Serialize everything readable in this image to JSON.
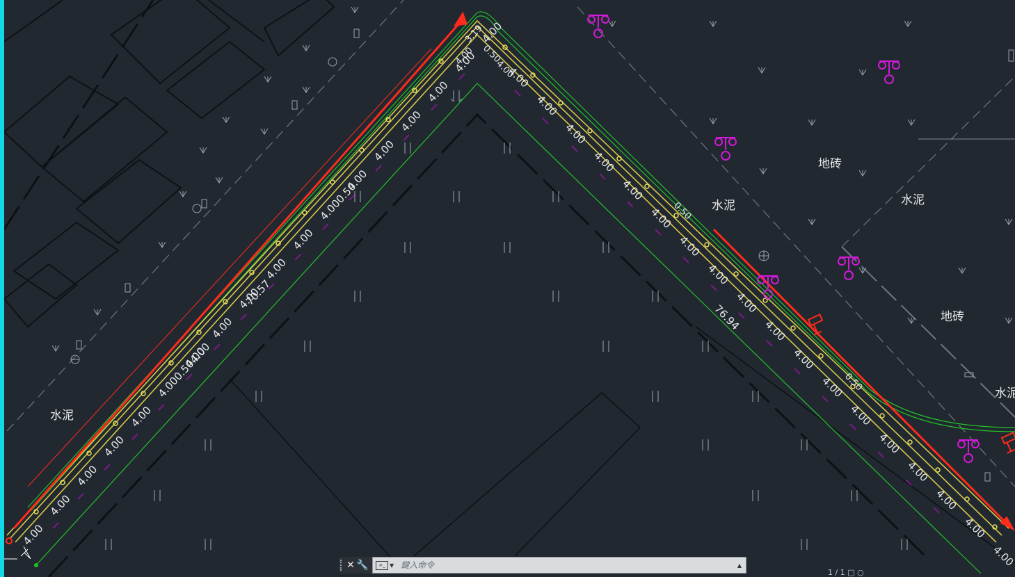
{
  "command_line": {
    "placeholder": "鍵入命令",
    "close_icon": "close-icon",
    "customize_icon": "wrench-icon",
    "prompt_icon": "command-prompt-icon",
    "history_icon": "chevron-up-icon"
  },
  "status_tail": "1 / 1  □  ○",
  "drawing": {
    "area_labels": [
      "水泥",
      "水泥",
      "水泥",
      "地砖",
      "地砖",
      "水泥"
    ],
    "dimensions_left": [
      "4.00",
      "4.00",
      "4.00",
      "4.00",
      "4.00",
      "4.000.504.00",
      "4.00",
      "4.00",
      "4.00",
      "4.00",
      "4.00",
      "4.000.50",
      "4.00",
      "4.00",
      "4.00",
      "4.00",
      "4.00",
      "4.00"
    ],
    "dimensions_right": [
      "4.00",
      "4.00",
      "4.00",
      "4.00",
      "4.00",
      "4.00",
      "4.00",
      "4.00",
      "4.00",
      "4.00",
      "4.00",
      "4.00",
      "4.00",
      "4.00",
      "4.00",
      "4.00",
      "4.00",
      "4.00"
    ],
    "apex_labels": [
      "3.19",
      "0.50",
      "4.00",
      "4.00"
    ],
    "length_left": "70.57",
    "length_right": "76.94",
    "inner_labels": [
      "0.50",
      "0.50"
    ],
    "colors": {
      "background": "#212830",
      "accent_cyan": "#12d8e8",
      "green_line": "#22c22a",
      "yellow_line": "#d8c84a",
      "red_arrow": "#ff2b1c",
      "magenta_symbol": "#d21ad8",
      "purple_tick": "#7a1a8a",
      "gray_line": "#6e7680",
      "dash_black": "#0d1115"
    }
  }
}
